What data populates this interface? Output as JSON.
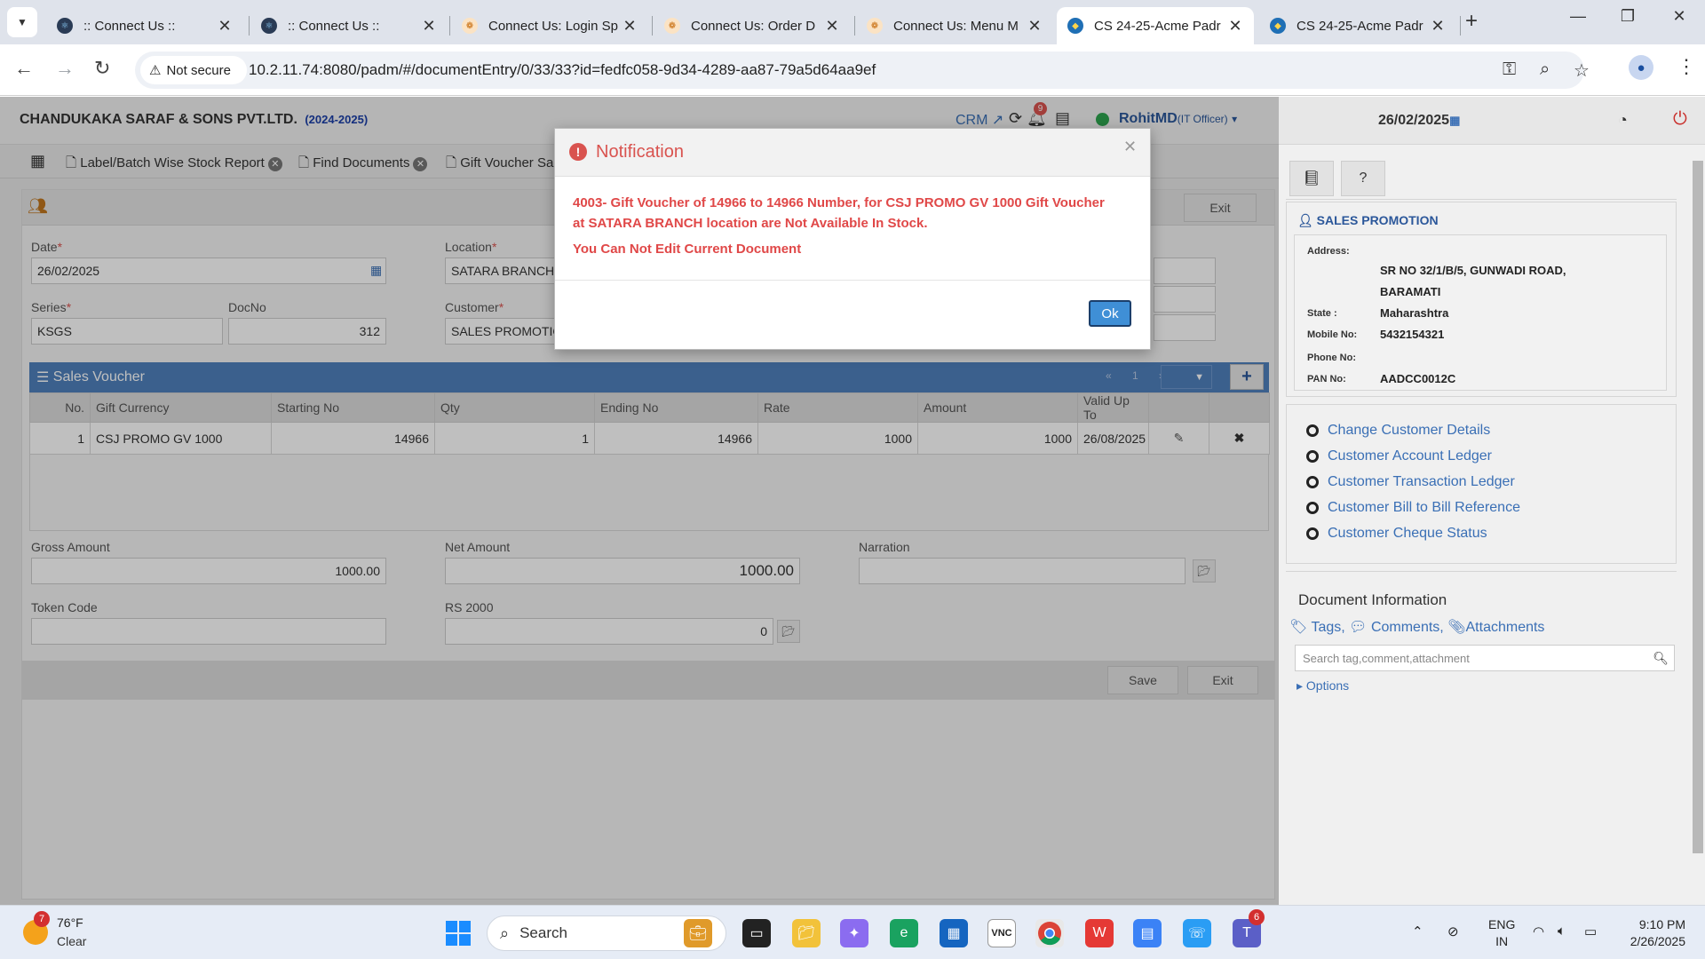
{
  "browser": {
    "tabs": [
      {
        "title": ":: Connect Us ::",
        "active": false
      },
      {
        "title": ":: Connect Us ::",
        "active": false
      },
      {
        "title": "Connect Us: Login Sp",
        "active": false
      },
      {
        "title": "Connect Us: Order D",
        "active": false
      },
      {
        "title": "Connect Us: Menu M",
        "active": false
      },
      {
        "title": "CS 24-25-Acme Padr",
        "active": true
      },
      {
        "title": "CS 24-25-Acme Padr",
        "active": false
      }
    ],
    "security_label": "Not secure",
    "url": "10.2.11.74:8080/padm/#/documentEntry/0/33/33?id=fedfc058-9d34-4289-aa87-79a5d64aa9ef"
  },
  "header": {
    "company": "CHANDUKAKA SARAF & SONS PVT.LTD.",
    "year": "(2024-2025)",
    "crm_label": "CRM",
    "notification_count": "9",
    "user_name": "RohitMD",
    "user_role": "(IT Officer)",
    "date": "26/02/2025"
  },
  "doc_tabs": [
    {
      "label": "Label/Batch Wise Stock Report"
    },
    {
      "label": "Find Documents"
    },
    {
      "label": "Gift Voucher Sal"
    }
  ],
  "form": {
    "exit_label": "Exit",
    "date_label": "Date",
    "date_value": "26/02/2025",
    "location_label": "Location",
    "location_value": "SATARA BRANCH",
    "series_label": "Series",
    "series_value": "KSGS",
    "docno_label": "DocNo",
    "docno_value": "312",
    "customer_label": "Customer",
    "customer_value": "SALES PROMOTIO"
  },
  "sales_voucher": {
    "title": "Sales Voucher",
    "pager": "« 1 »",
    "columns": [
      "No.",
      "Gift Currency",
      "Starting No",
      "Qty",
      "Ending No",
      "Rate",
      "Amount",
      "Valid Up To"
    ],
    "rows": [
      {
        "no": "1",
        "gift_currency": "CSJ PROMO GV 1000",
        "starting_no": "14966",
        "qty": "1",
        "ending_no": "14966",
        "rate": "1000",
        "amount": "1000",
        "valid_up_to": "26/08/2025"
      }
    ]
  },
  "totals": {
    "gross_label": "Gross Amount",
    "gross_value": "1000.00",
    "net_label": "Net Amount",
    "net_value": "1000.00",
    "narration_label": "Narration",
    "narration_value": "",
    "token_label": "Token Code",
    "token_value": "",
    "rs2000_label": "RS 2000",
    "rs2000_value": "0",
    "save_label": "Save",
    "exit_label": "Exit"
  },
  "sidebar": {
    "customer_title": "SALES PROMOTION",
    "address_label": "Address:",
    "address_line1": "SR NO 32/1/B/5, GUNWADI ROAD,",
    "address_line2": "BARAMATI",
    "state_label": "State :",
    "state_value": "Maharashtra",
    "mobile_label": "Mobile No:",
    "mobile_value": "5432154321",
    "phone_label": "Phone No:",
    "phone_value": "",
    "pan_label": "PAN No:",
    "pan_value": "AADCC0012C",
    "links": [
      "Change Customer Details",
      "Customer Account Ledger",
      "Customer Transaction Ledger",
      "Customer Bill to Bill Reference",
      "Customer Cheque Status"
    ],
    "doc_info_title": "Document Information",
    "tags_label": "Tags,",
    "comments_label": "Comments,",
    "attachments_label": "Attachments",
    "search_placeholder": "Search tag,comment,attachment",
    "options_label": "Options"
  },
  "modal": {
    "title": "Notification",
    "message_line1": "4003- Gift Voucher of 14966 to 14966 Number, for CSJ PROMO GV 1000 Gift Voucher",
    "message_line2": "at SATARA BRANCH location are Not Available In Stock.",
    "message_line3": "You Can Not Edit Current Document",
    "ok_label": "Ok"
  },
  "taskbar": {
    "weather_badge": "7",
    "temperature": "76°F",
    "condition": "Clear",
    "search_label": "Search",
    "teams_badge": "6",
    "lang_line1": "ENG",
    "lang_line2": "IN",
    "time": "9:10 PM",
    "date": "2/26/2025"
  },
  "colors": {
    "accent_blue": "#4f81bd",
    "error_red": "#e04848",
    "link_blue": "#3a6fb5"
  }
}
